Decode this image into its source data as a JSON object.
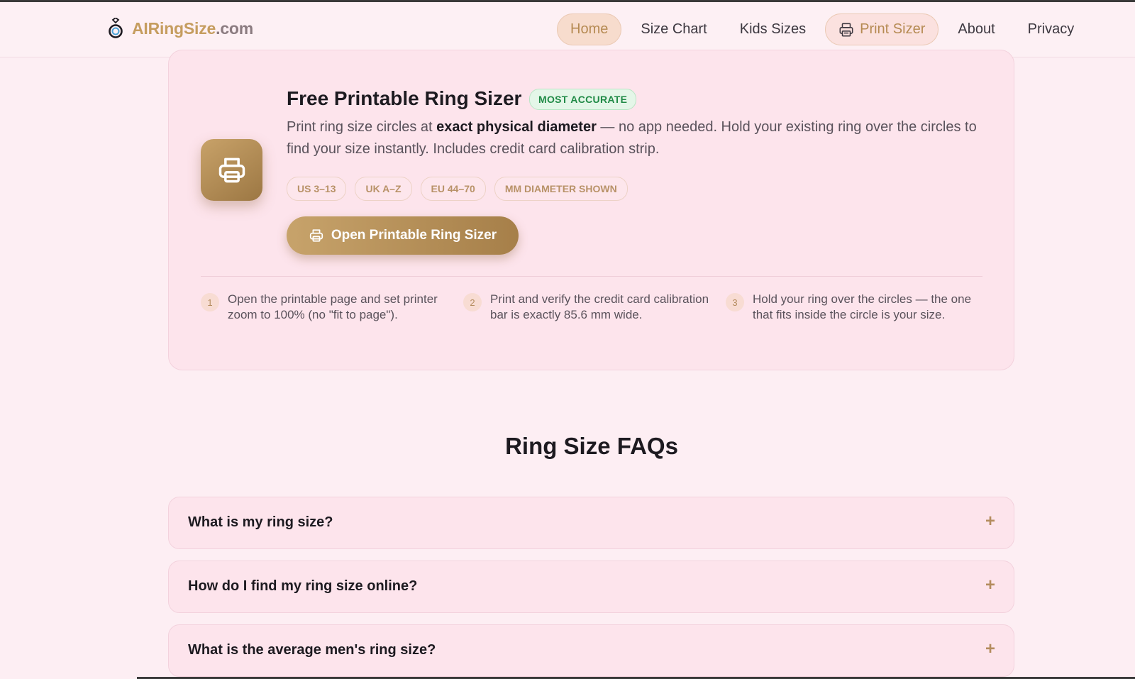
{
  "header": {
    "logo_brand": "AIRingSize",
    "logo_tld": ".com",
    "nav": [
      {
        "label": "Home",
        "state": "active"
      },
      {
        "label": "Size Chart"
      },
      {
        "label": "Kids Sizes"
      },
      {
        "label": "Print Sizer",
        "icon": "printer-icon",
        "state": "highlight"
      },
      {
        "label": "About"
      },
      {
        "label": "Privacy"
      }
    ]
  },
  "promo": {
    "icon": "printer-icon",
    "title": "Free Printable Ring Sizer",
    "badge": "MOST ACCURATE",
    "desc_pre": "Print ring size circles at ",
    "desc_bold": "exact physical diameter",
    "desc_post": " — no app needed. Hold your existing ring over the circles to find your size instantly. Includes credit card calibration strip.",
    "tags": [
      "US 3–13",
      "UK A–Z",
      "EU 44–70",
      "MM DIAMETER SHOWN"
    ],
    "cta_label": "Open Printable Ring Sizer",
    "steps": [
      {
        "num": "1",
        "text": "Open the printable page and set printer zoom to 100% (no \"fit to page\")."
      },
      {
        "num": "2",
        "text": "Print and verify the credit card calibration bar is exactly 85.6 mm wide."
      },
      {
        "num": "3",
        "text": "Hold your ring over the circles — the one that fits inside the circle is your size."
      }
    ]
  },
  "faq": {
    "title": "Ring Size FAQs",
    "items": [
      {
        "q": "What is my ring size?",
        "toggle": "+"
      },
      {
        "q": "How do I find my ring size online?",
        "toggle": "+"
      },
      {
        "q": "What is the average men's ring size?",
        "toggle": "+"
      }
    ]
  },
  "colors": {
    "accent": "#c59d5f",
    "background": "#fdeef3",
    "card": "#fde4ec",
    "badge_green": "#208a46"
  }
}
